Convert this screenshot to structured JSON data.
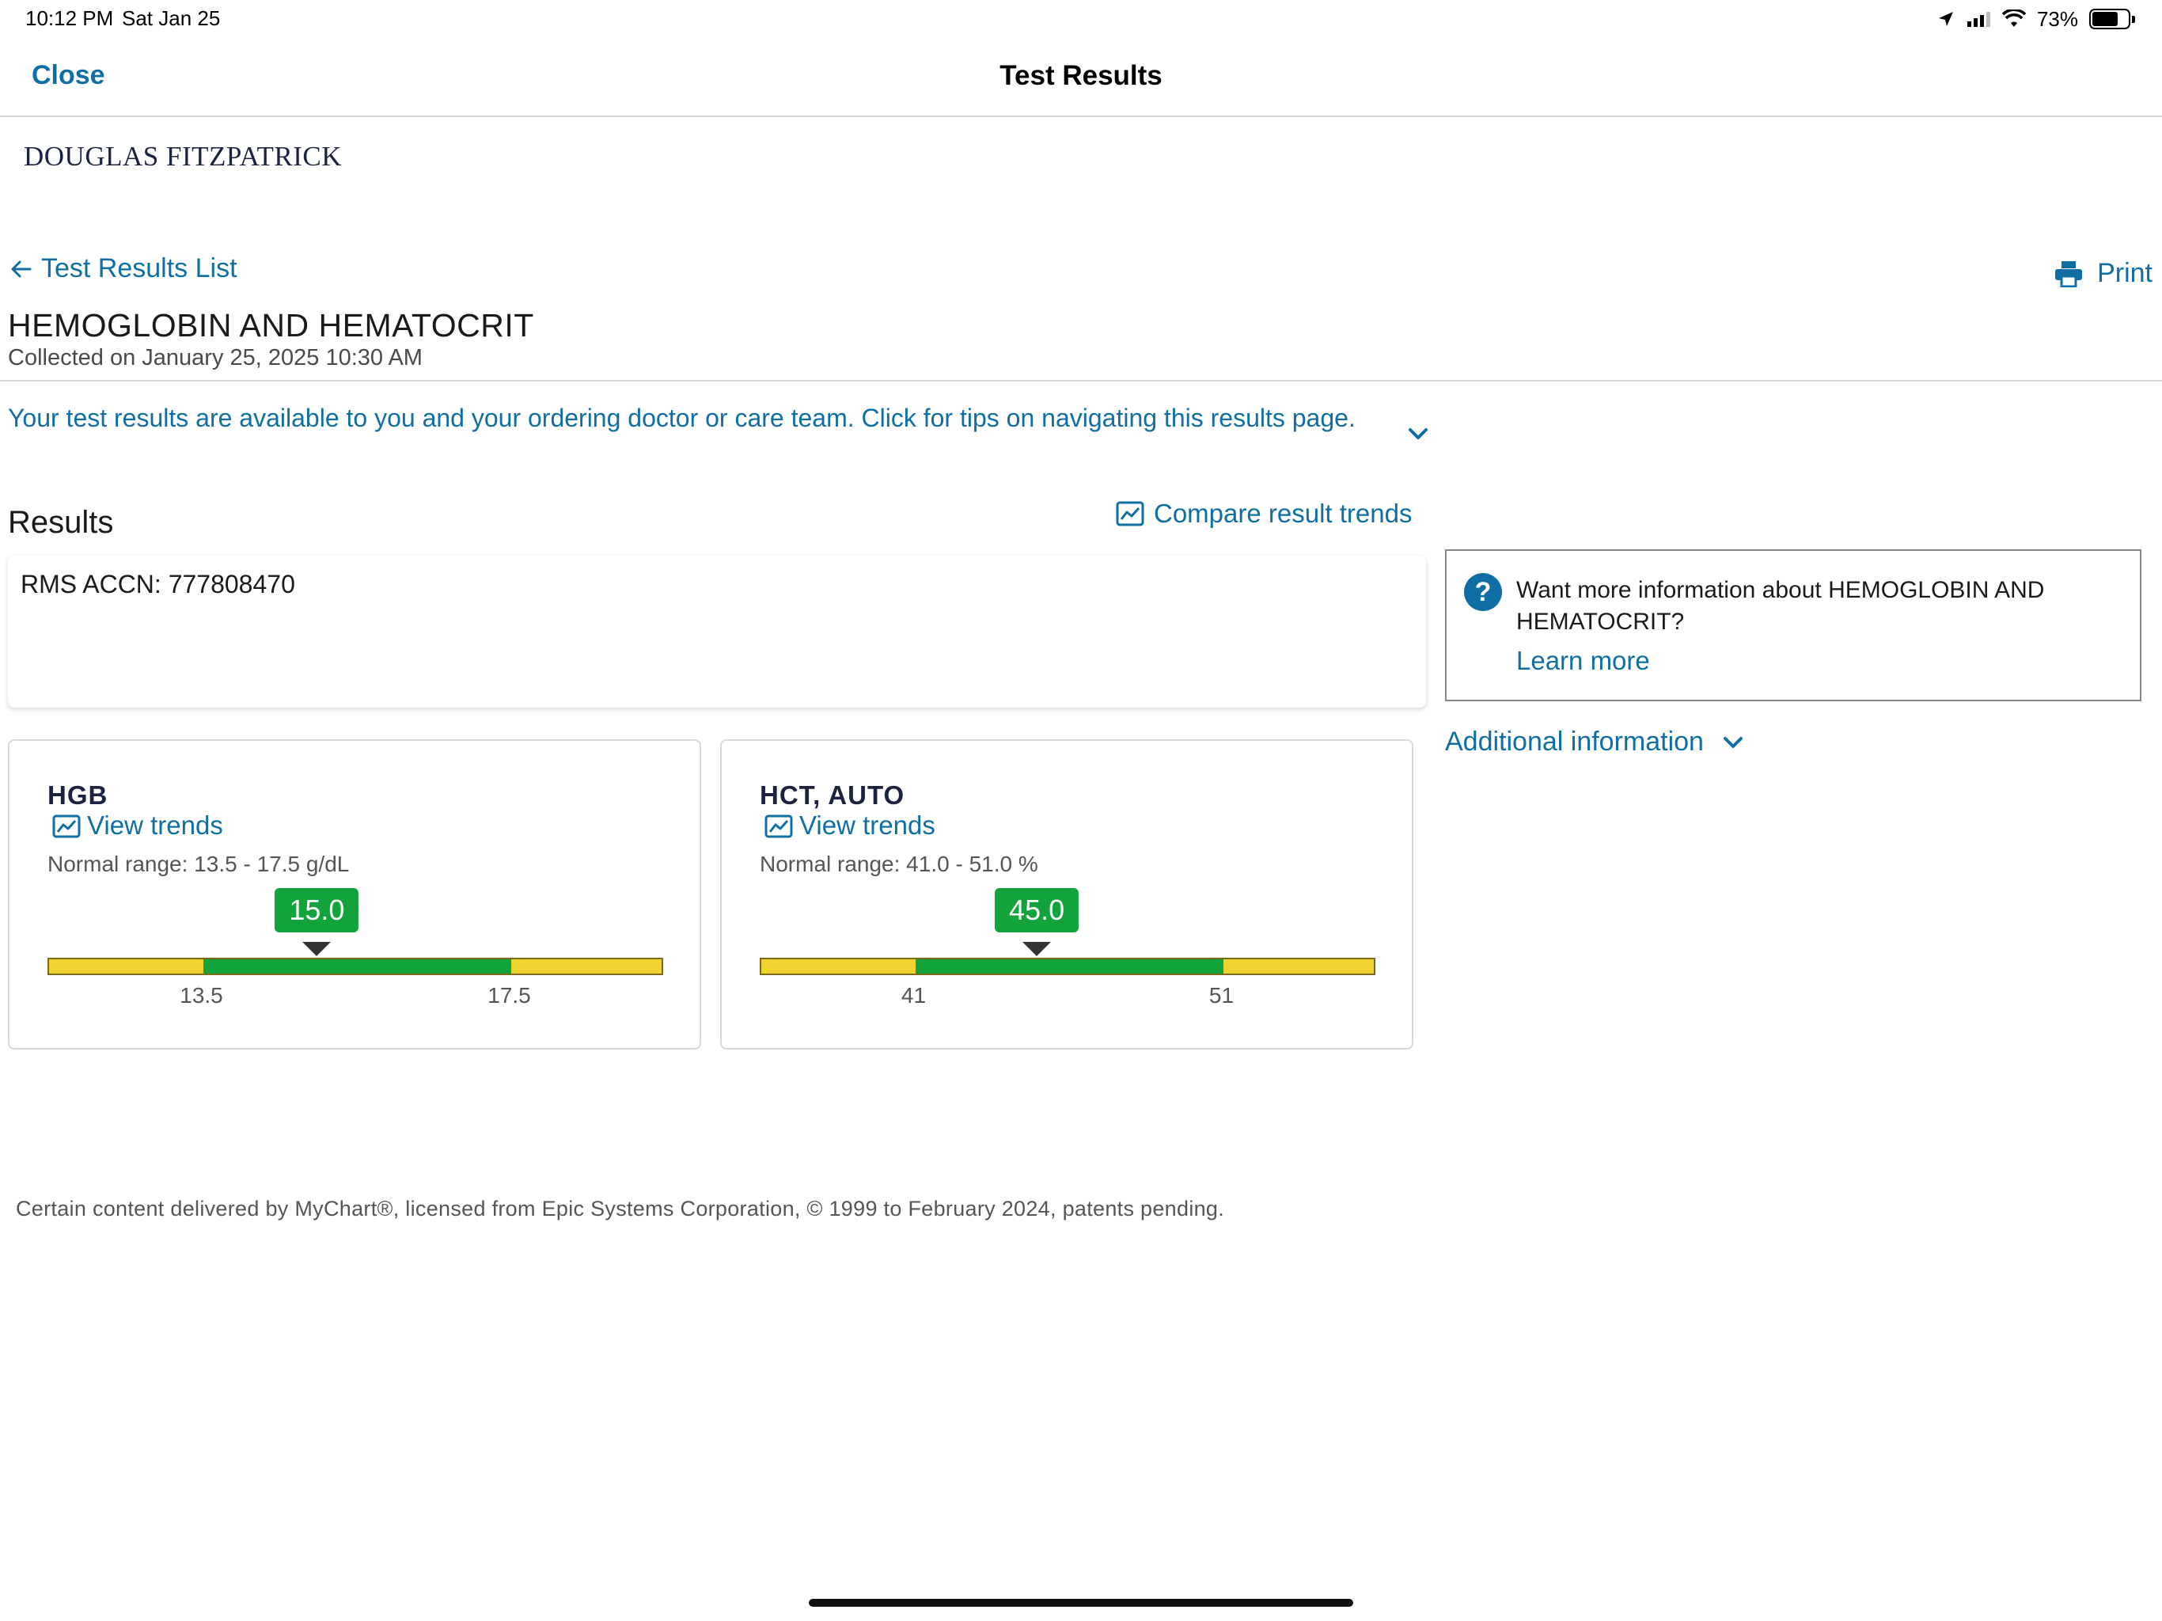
{
  "status_bar": {
    "time": "10:12 PM",
    "date": "Sat Jan 25",
    "battery_pct": "73%",
    "battery_level": 0.73
  },
  "nav": {
    "close_label": "Close",
    "title": "Test Results"
  },
  "patient": {
    "name": "DOUGLAS FITZPATRICK"
  },
  "back_link": {
    "label": "Test Results List",
    "icon": "arrow-left-icon"
  },
  "print": {
    "label": "Print",
    "icon": "printer-icon"
  },
  "test": {
    "title": "HEMOGLOBIN AND HEMATOCRIT",
    "collected": "Collected on January 25, 2025 10:30 AM"
  },
  "tips": {
    "text": "Your test results are available to you and your ordering doctor or care team. Click for tips on navigating this results page.",
    "icon": "chevron-down-icon"
  },
  "results": {
    "heading": "Results",
    "compare_label": "Compare result trends",
    "accn": "RMS ACCN: 777808470"
  },
  "components": [
    {
      "name": "HGB",
      "trends_label": "View trends",
      "range_text": "Normal range: 13.5 - 17.5 g/dL",
      "value": "15.0",
      "value_num": 15.0,
      "low": 13.5,
      "high": 17.5,
      "low_label": "13.5",
      "high_label": "17.5"
    },
    {
      "name": "HCT, AUTO",
      "trends_label": "View trends",
      "range_text": "Normal range: 41.0 - 51.0 %",
      "value": "45.0",
      "value_num": 45.0,
      "low": 41,
      "high": 51,
      "low_label": "41",
      "high_label": "51"
    }
  ],
  "info": {
    "question": "Want more information about HEMOGLOBIN AND HEMATOCRIT?",
    "learn_more": "Learn more"
  },
  "additional": {
    "label": "Additional information"
  },
  "footer": {
    "text": "Certain content delivered by MyChart®, licensed from Epic Systems Corporation, © 1999 to February 2024, patents pending."
  },
  "colors": {
    "accent": "#0f6fa5",
    "normal": "#12a33a",
    "out_of_range": "#f0d230"
  }
}
